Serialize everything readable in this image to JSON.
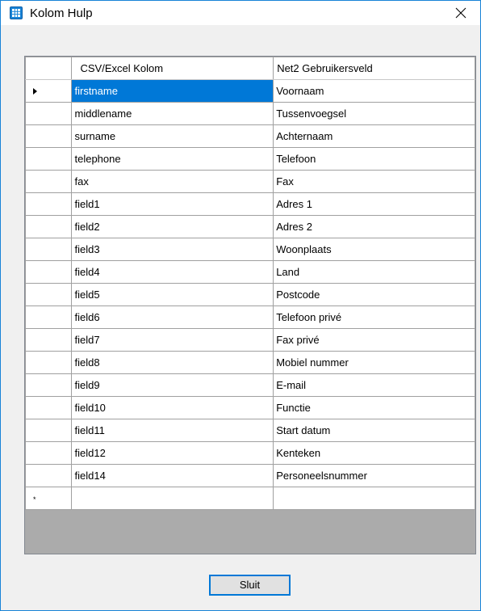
{
  "window": {
    "title": "Kolom Hulp",
    "icon": "table-grid-icon",
    "close_icon": "close-icon"
  },
  "grid": {
    "columns": [
      "CSV/Excel Kolom",
      "Net2 Gebruikersveld"
    ],
    "rows": [
      {
        "csv": "firstname",
        "net2": "Voornaam"
      },
      {
        "csv": "middlename",
        "net2": "Tussenvoegsel"
      },
      {
        "csv": "surname",
        "net2": "Achternaam"
      },
      {
        "csv": "telephone",
        "net2": "Telefoon"
      },
      {
        "csv": "fax",
        "net2": "Fax"
      },
      {
        "csv": "field1",
        "net2": "Adres 1"
      },
      {
        "csv": "field2",
        "net2": "Adres 2"
      },
      {
        "csv": "field3",
        "net2": "Woonplaats"
      },
      {
        "csv": "field4",
        "net2": "Land"
      },
      {
        "csv": "field5",
        "net2": "Postcode"
      },
      {
        "csv": "field6",
        "net2": "Telefoon privé"
      },
      {
        "csv": "field7",
        "net2": "Fax privé"
      },
      {
        "csv": "field8",
        "net2": "Mobiel nummer"
      },
      {
        "csv": "field9",
        "net2": "E-mail"
      },
      {
        "csv": "field10",
        "net2": "Functie"
      },
      {
        "csv": "field11",
        "net2": "Start datum"
      },
      {
        "csv": "field12",
        "net2": "Kenteken"
      },
      {
        "csv": "field14",
        "net2": "Personeelsnummer"
      }
    ],
    "new_row_marker": "*",
    "selected_row": 0
  },
  "buttons": {
    "close_label": "Sluit"
  },
  "colors": {
    "selection": "#0078d7",
    "window_border": "#1883d7",
    "grid_background": "#ababab"
  }
}
